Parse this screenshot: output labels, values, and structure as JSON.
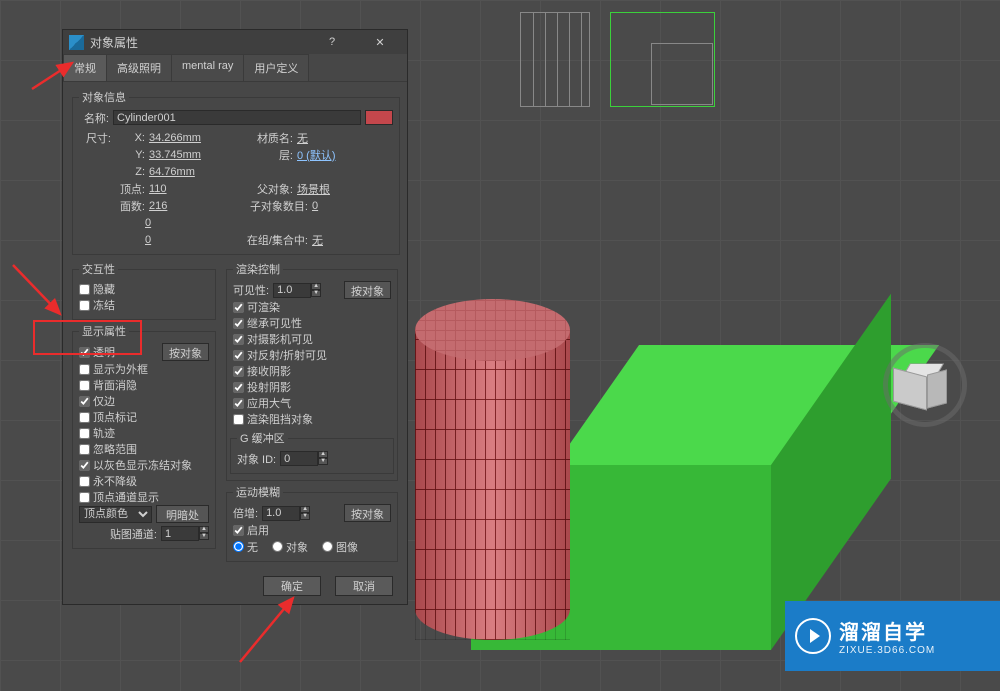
{
  "dialog": {
    "title": "对象属性",
    "tabs": {
      "general": "常规",
      "adv_light": "高级照明",
      "mental_ray": "mental ray",
      "user_def": "用户定义"
    },
    "obj_info": {
      "legend": "对象信息",
      "name_lbl": "名称:",
      "name_val": "Cylinder001",
      "dim_lbl": "尺寸:",
      "x_lbl": "X:",
      "x_val": "34.266mm",
      "y_lbl": "Y:",
      "y_val": "33.745mm",
      "z_lbl": "Z:",
      "z_val": "64.76mm",
      "verts_lbl": "顶点:",
      "verts_val": "110",
      "faces_lbl": "面数:",
      "faces_val": "216",
      "zero1": "0",
      "zero2": "0",
      "mat_lbl": "材质名:",
      "mat_val": "无",
      "layer_lbl": "层:",
      "layer_val": "0 (默认)",
      "parent_lbl": "父对象:",
      "parent_val": "场景根",
      "children_lbl": "子对象数目:",
      "children_val": "0",
      "group_lbl": "在组/集合中:",
      "group_val": "无"
    },
    "interactivity": {
      "legend": "交互性",
      "hide": "隐藏",
      "freeze": "冻结"
    },
    "display": {
      "legend": "显示属性",
      "see_through": "透明",
      "by_object": "按对象",
      "as_box": "显示为外框",
      "backface": "背面消隐",
      "edges_only": "仅边",
      "vertex_ticks": "顶点标记",
      "trajectory": "轨迹",
      "ignore_ext": "忽略范围",
      "gray_frozen": "以灰色显示冻结对象",
      "never_degrade": "永不降级",
      "vert_chan": "顶点通道显示",
      "vertex_color": "顶点颜色",
      "shaded": "明暗处理",
      "map_chan_lbl": "贴图通道:",
      "map_chan_val": "1"
    },
    "render": {
      "legend": "渲染控制",
      "visibility_lbl": "可见性:",
      "visibility_val": "1.0",
      "by_object": "按对象",
      "renderable": "可渲染",
      "inherit": "继承可见性",
      "vis_cam": "对摄影机可见",
      "vis_refl": "对反射/折射可见",
      "recv_shadow": "接收阴影",
      "cast_shadow": "投射阴影",
      "atmos": "应用大气",
      "occlusion": "渲染阻挡对象"
    },
    "gbuffer": {
      "legend": "G 缓冲区",
      "id_lbl": "对象 ID:",
      "id_val": "0"
    },
    "motion": {
      "legend": "运动模糊",
      "mult_lbl": "倍增:",
      "mult_val": "1.0",
      "by_object": "按对象",
      "enabled": "启用",
      "none": "无",
      "object": "对象",
      "image": "图像"
    },
    "ok": "确定",
    "cancel": "取消"
  },
  "watermark": {
    "title": "溜溜自学",
    "url": "ZIXUE.3D66.COM"
  }
}
